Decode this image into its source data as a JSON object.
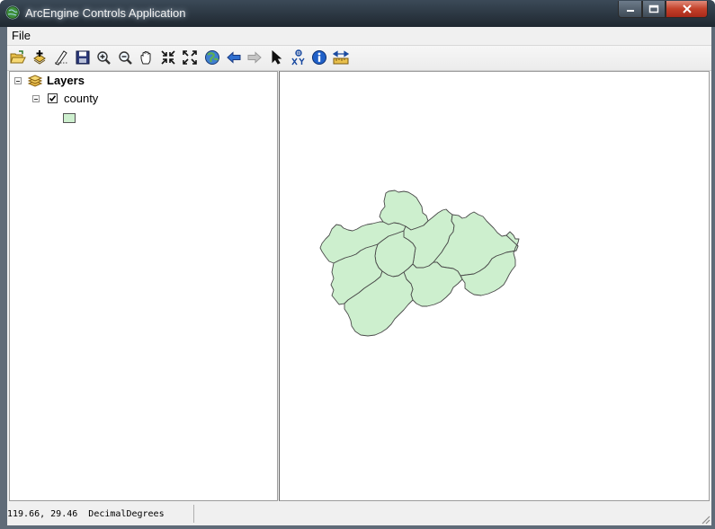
{
  "window": {
    "title": "ArcEngine Controls Application",
    "caption_buttons": [
      "minimize",
      "maximize",
      "close"
    ]
  },
  "menu": {
    "items": [
      {
        "label": "File"
      }
    ]
  },
  "toolbar": {
    "tools": [
      {
        "name": "open-document"
      },
      {
        "name": "add-data"
      },
      {
        "name": "edit-sketch"
      },
      {
        "name": "save"
      },
      {
        "name": "zoom-in"
      },
      {
        "name": "zoom-out"
      },
      {
        "name": "pan"
      },
      {
        "name": "fixed-zoom-in"
      },
      {
        "name": "fixed-zoom-out"
      },
      {
        "name": "full-extent"
      },
      {
        "name": "back"
      },
      {
        "name": "forward"
      },
      {
        "name": "select-elements"
      },
      {
        "name": "go-to-xy"
      },
      {
        "name": "identify"
      },
      {
        "name": "measure"
      }
    ]
  },
  "toc": {
    "root_label": "Layers",
    "layers": [
      {
        "label": "county",
        "checked": true,
        "fill_color": "#cdefce",
        "outline_color": "#555555"
      }
    ]
  },
  "map": {
    "feature_fill": "#cdefce",
    "feature_outline": "#4a4a4a"
  },
  "status": {
    "coordinates": "119.66, 29.46  DecimalDegrees"
  }
}
